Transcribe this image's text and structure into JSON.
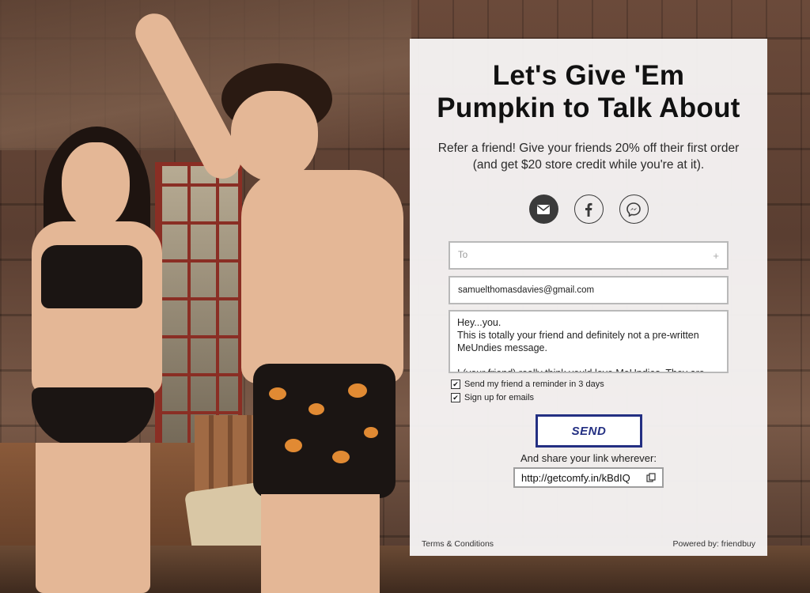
{
  "card": {
    "headline_line1": "Let's Give 'Em",
    "headline_line2": "Pumpkin to Talk About",
    "subtext": "Refer a friend! Give your friends 20% off their first order (and get $20 store credit while you're at it).",
    "share_icons": [
      "envelope-icon",
      "facebook-icon",
      "messenger-icon"
    ]
  },
  "form": {
    "to_placeholder": "To",
    "to_add": "+",
    "from_value": "samuelthomasdavies@gmail.com",
    "message": "Hey...you.\nThis is totally your friend and definitely not a pre-written MeUndies message.\n\nI (your friend) really think you'd love MeUndies. They are",
    "reminder_label": "Send my friend a reminder in 3 days",
    "reminder_checked": true,
    "signup_label": "Sign up for emails",
    "signup_checked": true,
    "send_label": "SEND"
  },
  "share_link": {
    "label": "And share your link wherever:",
    "url": "http://getcomfy.in/kBdIQ"
  },
  "footer": {
    "terms": "Terms & Conditions",
    "powered_by": "Powered by: friendbuy"
  },
  "colors": {
    "send_accent": "#232f82",
    "card_bg": "#f6f4f4"
  }
}
